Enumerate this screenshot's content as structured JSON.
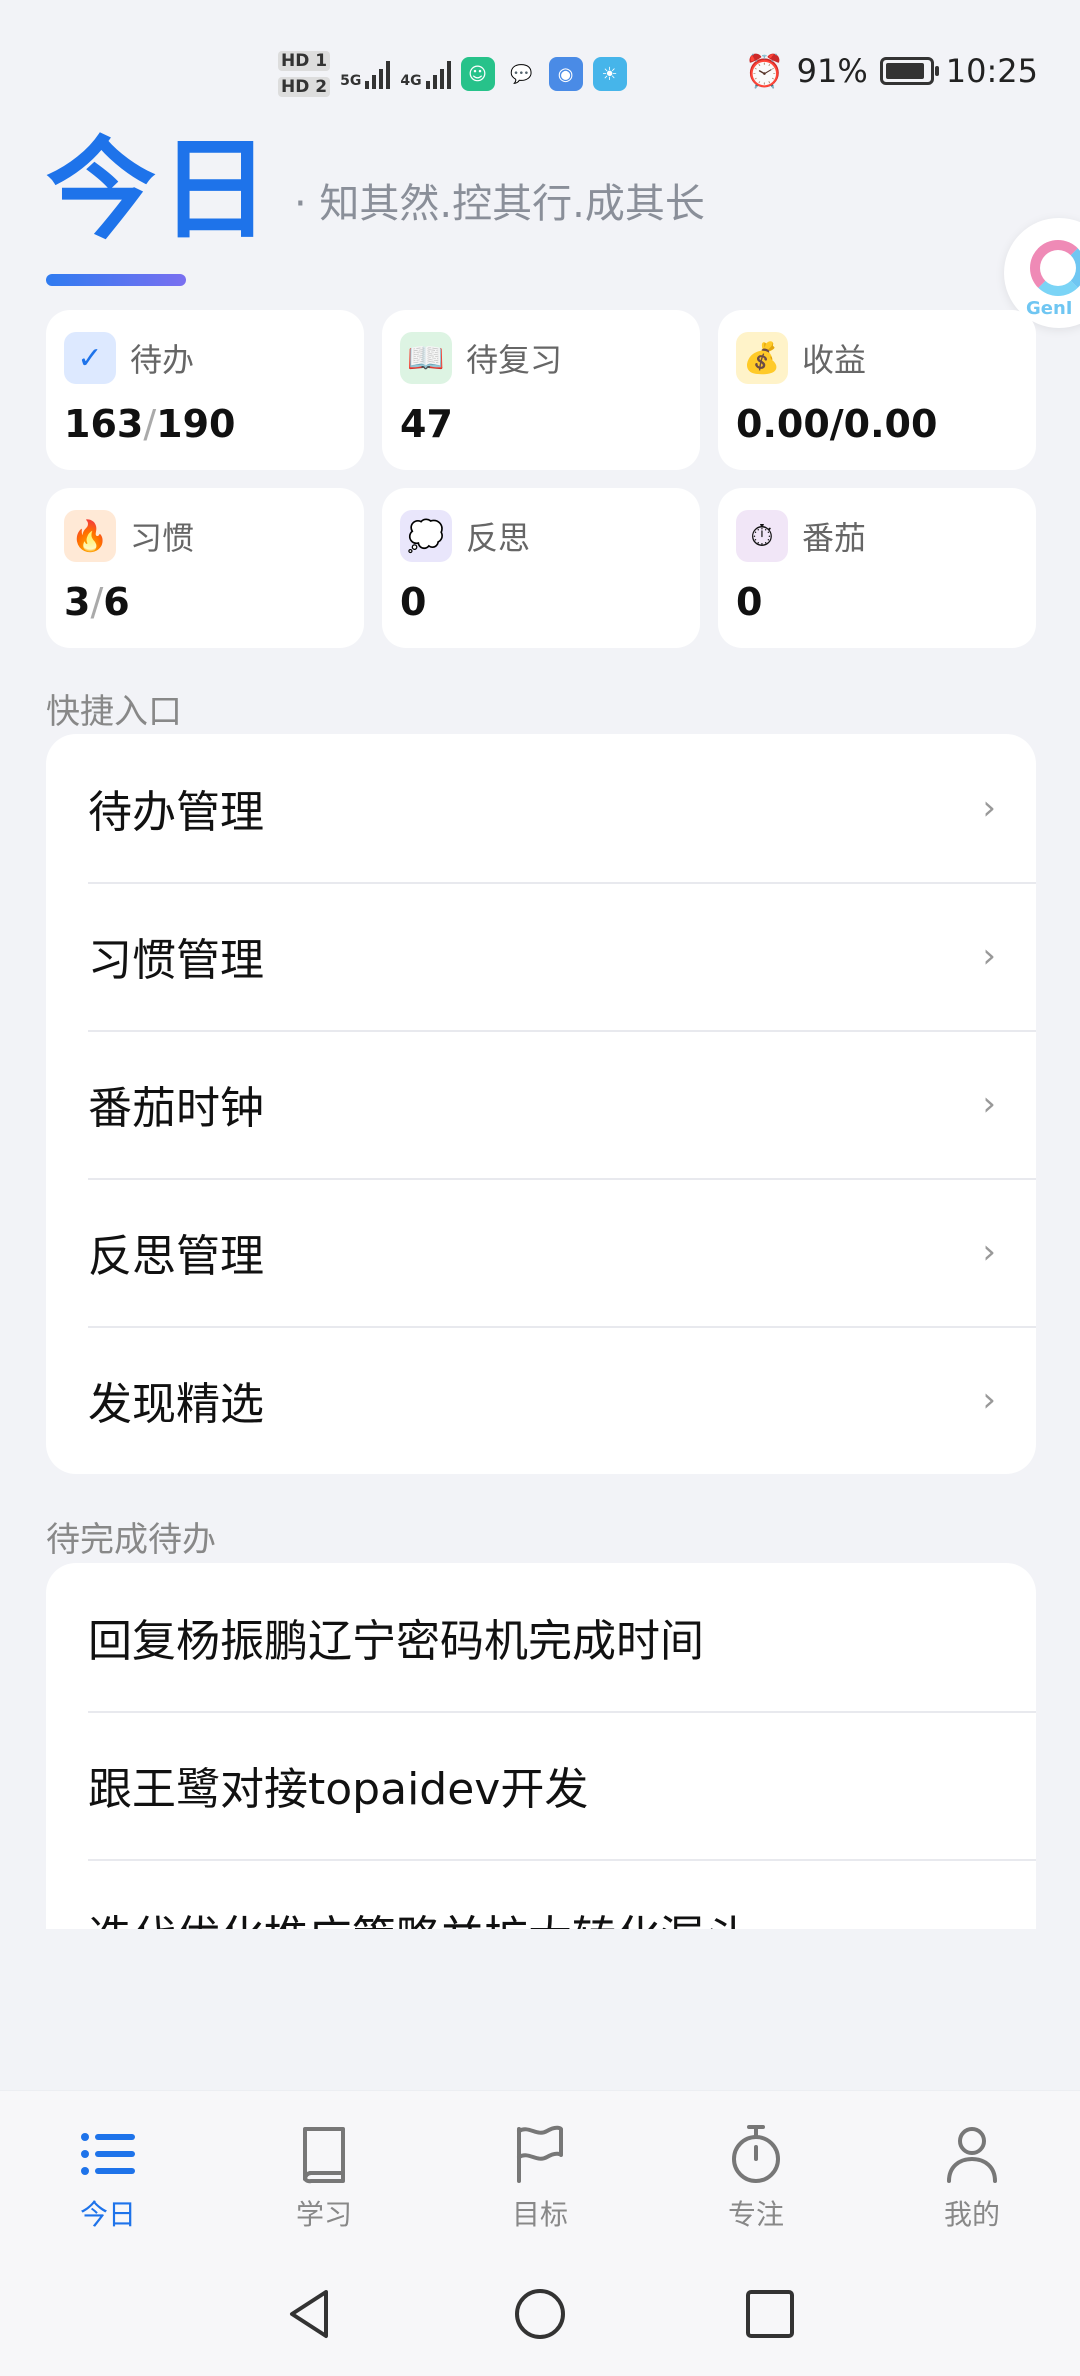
{
  "status_bar": {
    "sim1": "HD 1",
    "sim2": "HD 2",
    "net1": "5G",
    "net2": "4G",
    "battery_percent": "91%",
    "battery_level": 0.91,
    "time": "10:25"
  },
  "header": {
    "title": "今日",
    "slogan": "· 知其然.控其行.成其长"
  },
  "float_badge": {
    "text": "GenI"
  },
  "stats": [
    {
      "icon": "check-icon",
      "icon_glyph": "✓",
      "icon_bg": "#dde9ff",
      "label": "待办",
      "value_a": "163",
      "value_sep": "/",
      "value_b": "190"
    },
    {
      "icon": "book-icon",
      "icon_glyph": "📖",
      "icon_bg": "#ddf4e3",
      "label": "待复习",
      "value_a": "47",
      "value_sep": "",
      "value_b": ""
    },
    {
      "icon": "money-bag-icon",
      "icon_glyph": "💰",
      "icon_bg": "#fff3c9",
      "label": "收益",
      "value_a": "0.00/0.00",
      "value_sep": "",
      "value_b": ""
    },
    {
      "icon": "fire-icon",
      "icon_glyph": "🔥",
      "icon_bg": "#ffe9d6",
      "label": "习惯",
      "value_a": "3",
      "value_sep": "/",
      "value_b": "6"
    },
    {
      "icon": "thought-bubble-icon",
      "icon_glyph": "💭",
      "icon_bg": "#e9e6fb",
      "label": "反思",
      "value_a": "0",
      "value_sep": "",
      "value_b": ""
    },
    {
      "icon": "timer-icon",
      "icon_glyph": "⏱",
      "icon_bg": "#f1e6f7",
      "label": "番茄",
      "value_a": "0",
      "value_sep": "",
      "value_b": ""
    }
  ],
  "quick_entry": {
    "title": "快捷入口",
    "items": [
      {
        "label": "待办管理",
        "chevron": "›"
      },
      {
        "label": "习惯管理",
        "chevron": "›"
      },
      {
        "label": "番茄时钟",
        "chevron": "›"
      },
      {
        "label": "反思管理",
        "chevron": "›"
      },
      {
        "label": "发现精选",
        "chevron": "›"
      }
    ]
  },
  "pending_todos": {
    "title": "待完成待办",
    "items": [
      {
        "label": "回复杨振鹏辽宁密码机完成时间"
      },
      {
        "label": "跟王鹭对接topaidev开发"
      },
      {
        "label": "迭代优化推广策略并扩大转化漏斗"
      }
    ]
  },
  "bottom_nav": {
    "items": [
      {
        "label": "今日",
        "icon": "list-icon",
        "active": true
      },
      {
        "label": "学习",
        "icon": "book-icon",
        "active": false
      },
      {
        "label": "目标",
        "icon": "flag-icon",
        "active": false
      },
      {
        "label": "专注",
        "icon": "stopwatch-icon",
        "active": false
      },
      {
        "label": "我的",
        "icon": "person-icon",
        "active": false
      }
    ]
  },
  "colors": {
    "accent": "#1e73ea",
    "background": "#f2f3f7"
  }
}
